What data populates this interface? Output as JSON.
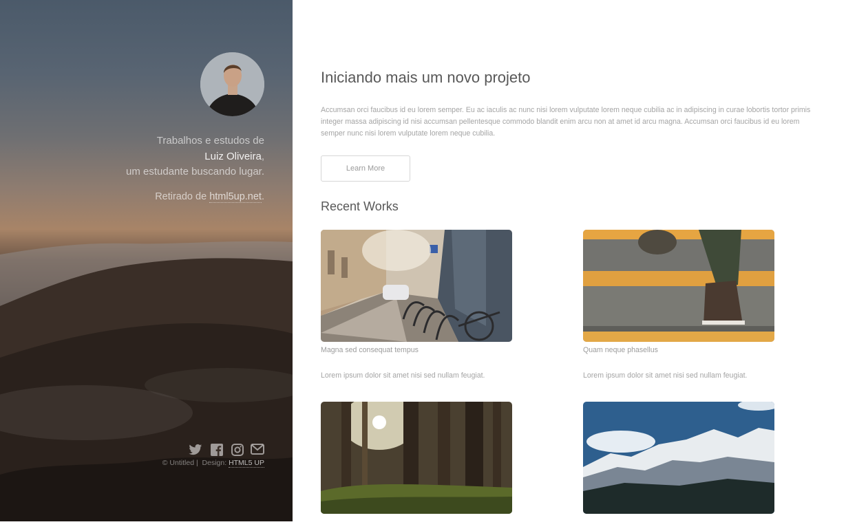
{
  "sidebar": {
    "intro_line1": "Trabalhos e estudos de",
    "name": "Luiz Oliveira",
    "intro_line2_suffix": ",",
    "intro_line3": "um estudante buscando lugar.",
    "source_prefix": "Retirado de ",
    "source_link": "html5up.net",
    "source_suffix": ".",
    "social_icons": [
      "twitter-icon",
      "facebook-icon",
      "instagram-icon",
      "envelope-icon"
    ],
    "copyright": "© Untitled |",
    "design_label": "Design:",
    "design_link": "HTML5 UP"
  },
  "main": {
    "title": "Iniciando mais um novo projeto",
    "lead": "Accumsan orci faucibus id eu lorem semper. Eu ac iaculis ac nunc nisi lorem vulputate lorem neque cubilia ac in adipiscing in curae lobortis tortor primis integer massa adipiscing id nisi accumsan pellentesque commodo blandit enim arcu non at amet id arcu magna. Accumsan orci faucibus id eu lorem semper nunc nisi lorem vulputate lorem neque cubilia.",
    "button_label": "Learn More",
    "recent_title": "Recent Works",
    "works": [
      {
        "caption": "Magna sed consequat tempus",
        "desc": "Lorem ipsum dolor sit amet nisi sed nullam feugiat."
      },
      {
        "caption": "Quam neque phasellus",
        "desc": "Lorem ipsum dolor sit amet nisi sed nullam feugiat."
      },
      {
        "caption": "",
        "desc": ""
      },
      {
        "caption": "",
        "desc": ""
      }
    ]
  },
  "colors": {
    "accent_text": "#585858",
    "muted_text": "#a4a4a4",
    "sidebar_sky": "#4b5a6a",
    "sidebar_dusk": "#a88467",
    "sidebar_ground": "#231c18"
  }
}
